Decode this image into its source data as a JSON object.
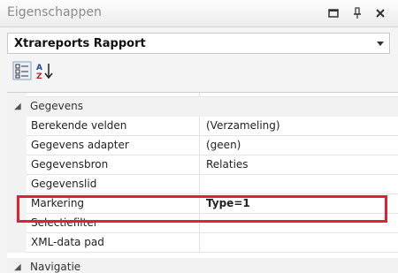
{
  "panel": {
    "title": "Eigenschappen",
    "buttons": [
      "maximize",
      "pin",
      "close"
    ]
  },
  "selector": {
    "label": "Xtrareports  Rapport"
  },
  "toolbar": {
    "buttons": [
      "categorized-icon",
      "alphabetical-sort-icon"
    ],
    "sort_glyph": "AZ"
  },
  "grid": {
    "category_gegevens": "Gegevens",
    "category_navigatie": "Navigatie",
    "rows": [
      {
        "name": "Berekende velden",
        "value": "(Verzameling)"
      },
      {
        "name": "Gegevens adapter",
        "value": "(geen)"
      },
      {
        "name": "Gegevensbron",
        "value": "Relaties"
      },
      {
        "name": "Gegevenslid",
        "value": ""
      },
      {
        "name": "Markering",
        "value": "Type=1"
      },
      {
        "name": "Selectiefilter",
        "value": ""
      },
      {
        "name": "XML-data pad",
        "value": ""
      }
    ]
  },
  "colors": {
    "highlight": "#e4202a"
  }
}
